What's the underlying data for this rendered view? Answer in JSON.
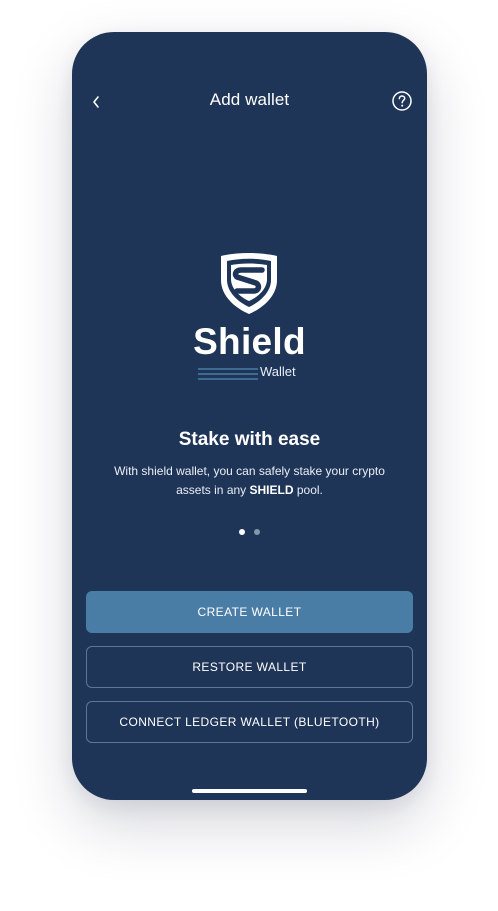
{
  "header": {
    "title": "Add wallet",
    "back_icon": "chevron-left-icon",
    "help_icon": "question-circle-icon"
  },
  "logo": {
    "icon": "shield-logo-icon",
    "wordmark": "Shield",
    "subtitle": "Wallet"
  },
  "onboarding": {
    "headline": "Stake with ease",
    "body_prefix": "With shield wallet, you can safely stake your crypto assets in any ",
    "body_bold": "SHIELD",
    "body_suffix": " pool.",
    "page_count": 2,
    "active_page": 1
  },
  "actions": {
    "create_label": "CREATE WALLET",
    "restore_label": "RESTORE WALLET",
    "ledger_label": "CONNECT LEDGER WALLET (BLUETOOTH)"
  },
  "colors": {
    "background": "#1f3558",
    "primary_button": "#4a7da5",
    "outline_border": "#5c7796",
    "logo_lines": "#4a7da5",
    "text": "#ffffff"
  }
}
